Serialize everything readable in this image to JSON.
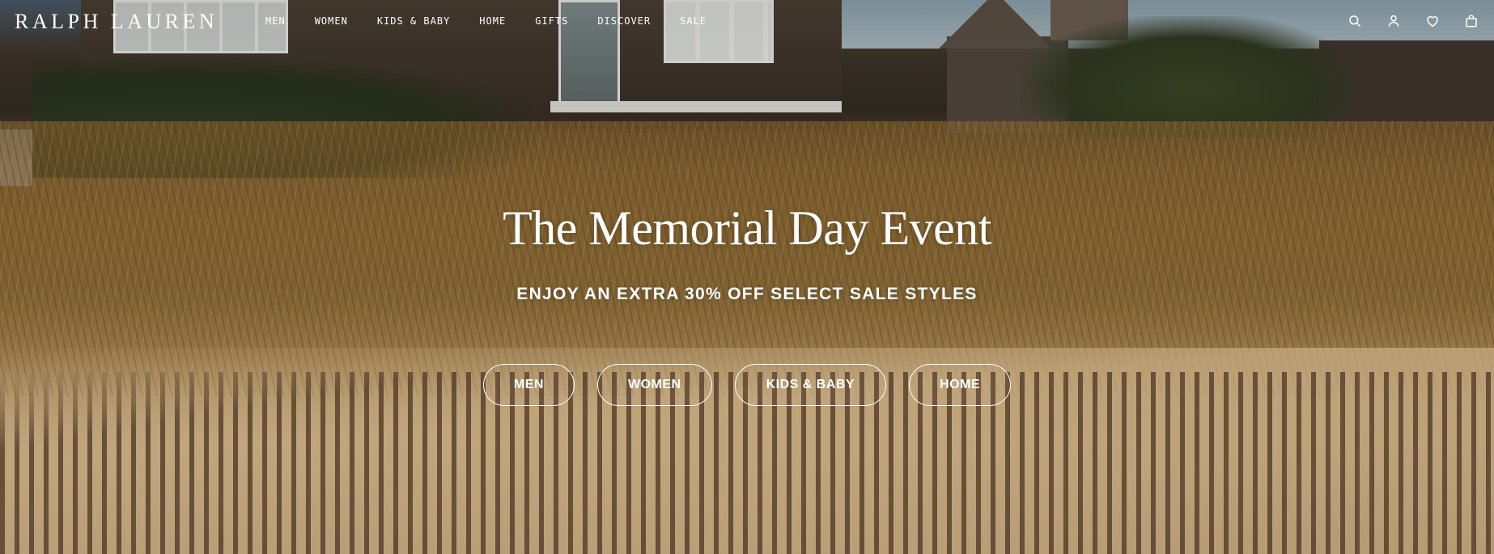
{
  "header": {
    "logo": "RALPH LAUREN",
    "nav": [
      {
        "label": "MEN"
      },
      {
        "label": "WOMEN"
      },
      {
        "label": "KIDS & BABY"
      },
      {
        "label": "HOME"
      },
      {
        "label": "GIFTS"
      },
      {
        "label": "DISCOVER"
      },
      {
        "label": "SALE"
      }
    ],
    "utility_icons": [
      "search-icon",
      "account-icon",
      "heart-icon",
      "bag-icon"
    ]
  },
  "hero": {
    "title": "The Memorial Day Event",
    "subtitle": "ENJOY AN EXTRA 30% OFF SELECT SALE STYLES",
    "buttons": [
      {
        "label": "MEN"
      },
      {
        "label": "WOMEN"
      },
      {
        "label": "KIDS & BABY"
      },
      {
        "label": "HOME"
      }
    ]
  },
  "colors": {
    "text": "#ffffff",
    "button_border": "#ffffff"
  }
}
